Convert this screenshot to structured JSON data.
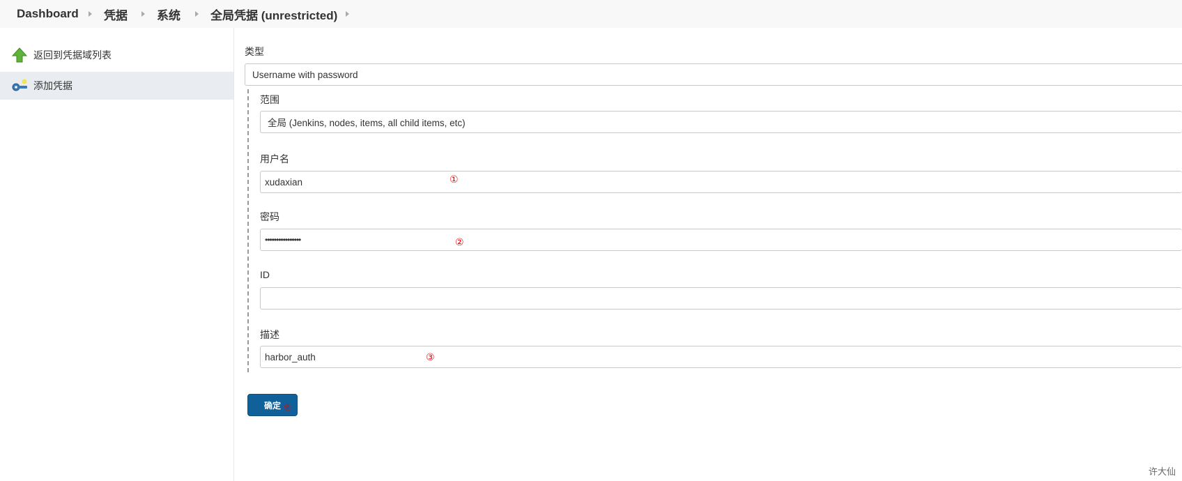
{
  "breadcrumb": {
    "items": [
      "Dashboard",
      "凭据",
      "系统",
      "全局凭据 (unrestricted)"
    ]
  },
  "sidebar": {
    "items": [
      {
        "label": "返回到凭据域列表",
        "icon": "up-arrow-icon"
      },
      {
        "label": "添加凭据",
        "icon": "key-icon"
      }
    ]
  },
  "form": {
    "kind_label": "类型",
    "kind_value": "Username with password",
    "scope_label": "范围",
    "scope_value": "全局 (Jenkins, nodes, items, all child items, etc)",
    "username_label": "用户名",
    "username_value": "xudaxian",
    "password_label": "密码",
    "password_value": "••••••••••••••••",
    "id_label": "ID",
    "id_value": "",
    "description_label": "描述",
    "description_value": "harbor_auth",
    "submit_label": "确定"
  },
  "annotations": {
    "a1": "①",
    "a2": "②",
    "a3": "③",
    "a4": "④"
  },
  "watermark": "许大仙",
  "colors": {
    "button": "#10619a",
    "annotation": "#e00000",
    "active_item": "#e9edf1"
  }
}
